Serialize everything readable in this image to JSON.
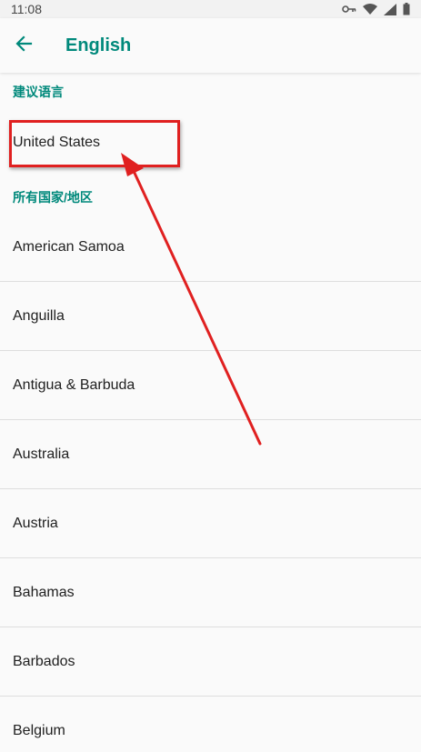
{
  "status_bar": {
    "time": "11:08",
    "icons": [
      "vpn-key-icon",
      "wifi-icon",
      "cell-signal-icon",
      "battery-icon"
    ]
  },
  "app_bar": {
    "back_icon": "arrow-back-icon",
    "title": "English"
  },
  "sections": {
    "suggested": {
      "header": "建议语言",
      "items": [
        "United States"
      ]
    },
    "all": {
      "header": "所有国家/地区",
      "items": [
        "American Samoa",
        "Anguilla",
        "Antigua & Barbuda",
        "Australia",
        "Austria",
        "Bahamas",
        "Barbados",
        "Belgium"
      ]
    }
  },
  "annotation": {
    "highlight_color": "#e02020",
    "target": "United States"
  },
  "colors": {
    "accent": "#00897b",
    "background": "#fafafa",
    "divider": "#dedede"
  }
}
